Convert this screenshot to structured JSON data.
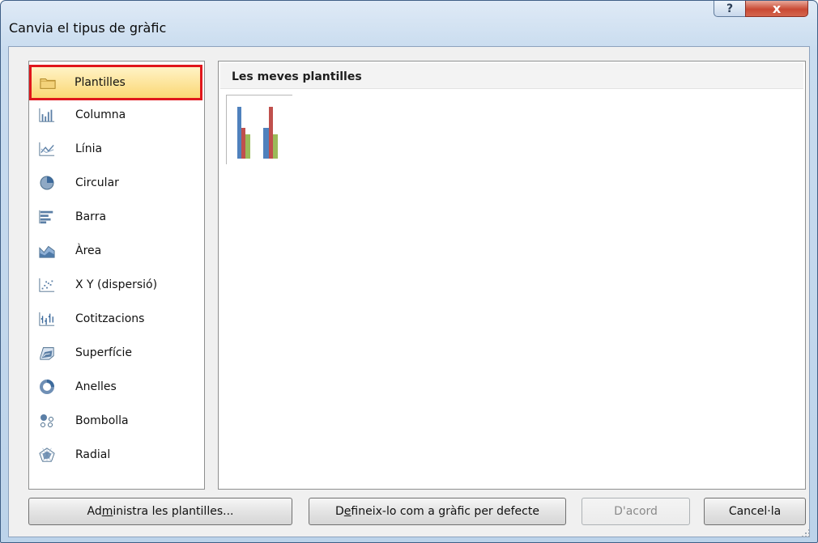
{
  "window": {
    "title": "Canvia el tipus de gràfic",
    "help_label": "?",
    "close_label": "x"
  },
  "categories": [
    {
      "label": "Plantilles",
      "icon": "folder-icon",
      "selected": true
    },
    {
      "label": "Columna",
      "icon": "column-chart-icon"
    },
    {
      "label": "Línia",
      "icon": "line-chart-icon"
    },
    {
      "label": "Circular",
      "icon": "pie-chart-icon"
    },
    {
      "label": "Barra",
      "icon": "bar-chart-icon"
    },
    {
      "label": "Àrea",
      "icon": "area-chart-icon"
    },
    {
      "label": "X Y (dispersió)",
      "icon": "scatter-chart-icon"
    },
    {
      "label": "Cotitzacions",
      "icon": "stock-chart-icon"
    },
    {
      "label": "Superfície",
      "icon": "surface-chart-icon"
    },
    {
      "label": "Anelles",
      "icon": "doughnut-chart-icon"
    },
    {
      "label": "Bombolla",
      "icon": "bubble-chart-icon"
    },
    {
      "label": "Radial",
      "icon": "radar-chart-icon"
    }
  ],
  "templates_section": {
    "title": "Les meves plantilles",
    "thumbnail_icon": "column-chart-template-thumbnail",
    "series_colors": [
      "#4f81bd",
      "#c0504d",
      "#9bbb59"
    ]
  },
  "buttons": {
    "manage_prefix": "Ad",
    "manage_key": "m",
    "manage_suffix": "inistra les plantilles...",
    "default_prefix": "D",
    "default_key": "e",
    "default_suffix": "fineix-lo com a gràfic per defecte",
    "ok_label": "D'acord",
    "cancel_label": "Cancel·la"
  },
  "colors": {
    "selection_border": "#e0161c",
    "selection_fill": "#fbd774",
    "close_button": "#c94a34"
  }
}
